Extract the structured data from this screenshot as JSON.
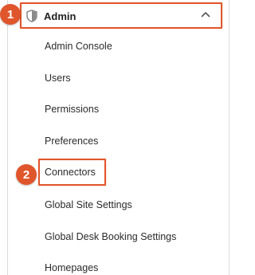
{
  "menu": {
    "header_label": "Admin",
    "header_icon": "shield-icon",
    "expanded_icon": "chevron-up-icon",
    "items": [
      {
        "label": "Admin Console"
      },
      {
        "label": "Users"
      },
      {
        "label": "Permissions"
      },
      {
        "label": "Preferences"
      },
      {
        "label": "Connectors"
      },
      {
        "label": "Global Site Settings"
      },
      {
        "label": "Global Desk Booking Settings"
      },
      {
        "label": "Homepages"
      }
    ]
  },
  "annotations": {
    "step1": "1",
    "step2": "2",
    "highlight_color": "#e0562c"
  }
}
